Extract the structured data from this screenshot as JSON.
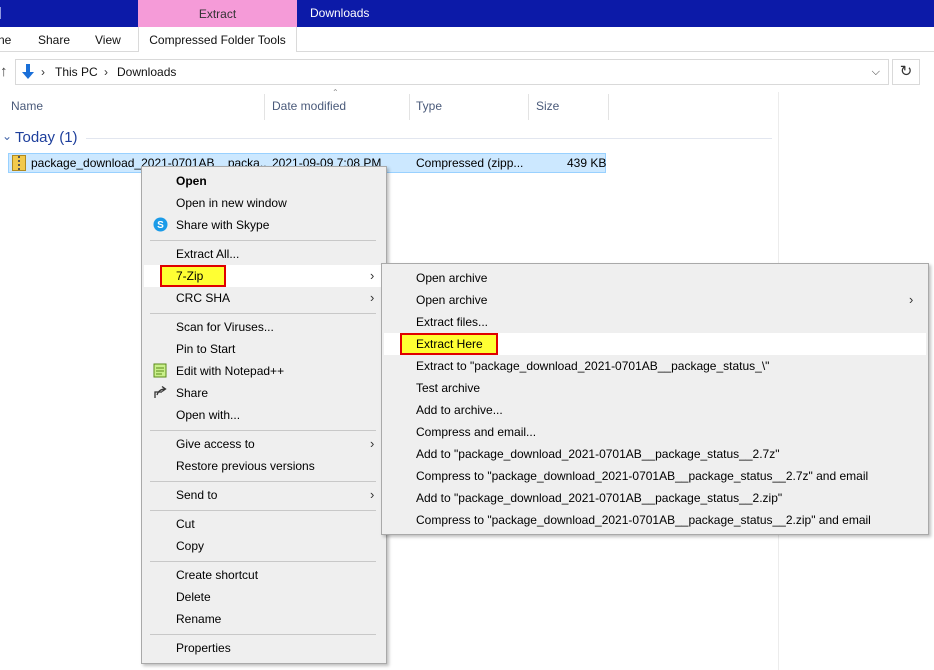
{
  "titlebar": {
    "context_tab": "Extract",
    "window_title": "Downloads"
  },
  "ribbon": {
    "tabs": [
      "ne",
      "Share",
      "View",
      "Compressed Folder Tools"
    ]
  },
  "address": {
    "crumbs": [
      "This PC",
      "Downloads"
    ]
  },
  "columns": [
    "Name",
    "Date modified",
    "Type",
    "Size"
  ],
  "group": {
    "title": "Today (1)"
  },
  "file": {
    "name": "package_download_2021-0701AB__packa...",
    "date": "2021-09-09 7:08 PM",
    "type": "Compressed (zipp...",
    "size": "439 KB"
  },
  "context_menu": {
    "items": [
      "Open",
      "Open in new window",
      "Share with Skype",
      "Extract All...",
      "7-Zip",
      "CRC SHA",
      "Scan for Viruses...",
      "Pin to Start",
      "Edit with Notepad++",
      "Share",
      "Open with...",
      "Give access to",
      "Restore previous versions",
      "Send to",
      "Cut",
      "Copy",
      "Create shortcut",
      "Delete",
      "Rename",
      "Properties"
    ]
  },
  "submenu": {
    "items": [
      "Open archive",
      "Open archive",
      "Extract files...",
      "Extract Here",
      "Extract to \"package_download_2021-0701AB__package_status_\\\"",
      "Test archive",
      "Add to archive...",
      "Compress and email...",
      "Add to \"package_download_2021-0701AB__package_status__2.7z\"",
      "Compress to \"package_download_2021-0701AB__package_status__2.7z\" and email",
      "Add to \"package_download_2021-0701AB__package_status__2.zip\"",
      "Compress to \"package_download_2021-0701AB__package_status__2.zip\" and email"
    ]
  },
  "colors": {
    "titlebar": "#0c1aa8",
    "context_tab": "#f59bd8",
    "selection": "#cce8ff",
    "highlight_fill": "#ffff33",
    "highlight_border": "#e00000"
  }
}
